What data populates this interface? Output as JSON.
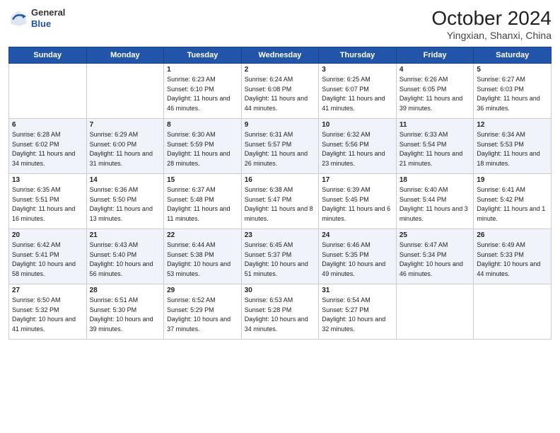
{
  "header": {
    "logo_line1": "General",
    "logo_line2": "Blue",
    "title": "October 2024",
    "subtitle": "Yingxian, Shanxi, China"
  },
  "days_of_week": [
    "Sunday",
    "Monday",
    "Tuesday",
    "Wednesday",
    "Thursday",
    "Friday",
    "Saturday"
  ],
  "weeks": [
    [
      {
        "day": "",
        "info": ""
      },
      {
        "day": "",
        "info": ""
      },
      {
        "day": "1",
        "info": "Sunrise: 6:23 AM\nSunset: 6:10 PM\nDaylight: 11 hours and 46 minutes."
      },
      {
        "day": "2",
        "info": "Sunrise: 6:24 AM\nSunset: 6:08 PM\nDaylight: 11 hours and 44 minutes."
      },
      {
        "day": "3",
        "info": "Sunrise: 6:25 AM\nSunset: 6:07 PM\nDaylight: 11 hours and 41 minutes."
      },
      {
        "day": "4",
        "info": "Sunrise: 6:26 AM\nSunset: 6:05 PM\nDaylight: 11 hours and 39 minutes."
      },
      {
        "day": "5",
        "info": "Sunrise: 6:27 AM\nSunset: 6:03 PM\nDaylight: 11 hours and 36 minutes."
      }
    ],
    [
      {
        "day": "6",
        "info": "Sunrise: 6:28 AM\nSunset: 6:02 PM\nDaylight: 11 hours and 34 minutes."
      },
      {
        "day": "7",
        "info": "Sunrise: 6:29 AM\nSunset: 6:00 PM\nDaylight: 11 hours and 31 minutes."
      },
      {
        "day": "8",
        "info": "Sunrise: 6:30 AM\nSunset: 5:59 PM\nDaylight: 11 hours and 28 minutes."
      },
      {
        "day": "9",
        "info": "Sunrise: 6:31 AM\nSunset: 5:57 PM\nDaylight: 11 hours and 26 minutes."
      },
      {
        "day": "10",
        "info": "Sunrise: 6:32 AM\nSunset: 5:56 PM\nDaylight: 11 hours and 23 minutes."
      },
      {
        "day": "11",
        "info": "Sunrise: 6:33 AM\nSunset: 5:54 PM\nDaylight: 11 hours and 21 minutes."
      },
      {
        "day": "12",
        "info": "Sunrise: 6:34 AM\nSunset: 5:53 PM\nDaylight: 11 hours and 18 minutes."
      }
    ],
    [
      {
        "day": "13",
        "info": "Sunrise: 6:35 AM\nSunset: 5:51 PM\nDaylight: 11 hours and 16 minutes."
      },
      {
        "day": "14",
        "info": "Sunrise: 6:36 AM\nSunset: 5:50 PM\nDaylight: 11 hours and 13 minutes."
      },
      {
        "day": "15",
        "info": "Sunrise: 6:37 AM\nSunset: 5:48 PM\nDaylight: 11 hours and 11 minutes."
      },
      {
        "day": "16",
        "info": "Sunrise: 6:38 AM\nSunset: 5:47 PM\nDaylight: 11 hours and 8 minutes."
      },
      {
        "day": "17",
        "info": "Sunrise: 6:39 AM\nSunset: 5:45 PM\nDaylight: 11 hours and 6 minutes."
      },
      {
        "day": "18",
        "info": "Sunrise: 6:40 AM\nSunset: 5:44 PM\nDaylight: 11 hours and 3 minutes."
      },
      {
        "day": "19",
        "info": "Sunrise: 6:41 AM\nSunset: 5:42 PM\nDaylight: 11 hours and 1 minute."
      }
    ],
    [
      {
        "day": "20",
        "info": "Sunrise: 6:42 AM\nSunset: 5:41 PM\nDaylight: 10 hours and 58 minutes."
      },
      {
        "day": "21",
        "info": "Sunrise: 6:43 AM\nSunset: 5:40 PM\nDaylight: 10 hours and 56 minutes."
      },
      {
        "day": "22",
        "info": "Sunrise: 6:44 AM\nSunset: 5:38 PM\nDaylight: 10 hours and 53 minutes."
      },
      {
        "day": "23",
        "info": "Sunrise: 6:45 AM\nSunset: 5:37 PM\nDaylight: 10 hours and 51 minutes."
      },
      {
        "day": "24",
        "info": "Sunrise: 6:46 AM\nSunset: 5:35 PM\nDaylight: 10 hours and 49 minutes."
      },
      {
        "day": "25",
        "info": "Sunrise: 6:47 AM\nSunset: 5:34 PM\nDaylight: 10 hours and 46 minutes."
      },
      {
        "day": "26",
        "info": "Sunrise: 6:49 AM\nSunset: 5:33 PM\nDaylight: 10 hours and 44 minutes."
      }
    ],
    [
      {
        "day": "27",
        "info": "Sunrise: 6:50 AM\nSunset: 5:32 PM\nDaylight: 10 hours and 41 minutes."
      },
      {
        "day": "28",
        "info": "Sunrise: 6:51 AM\nSunset: 5:30 PM\nDaylight: 10 hours and 39 minutes."
      },
      {
        "day": "29",
        "info": "Sunrise: 6:52 AM\nSunset: 5:29 PM\nDaylight: 10 hours and 37 minutes."
      },
      {
        "day": "30",
        "info": "Sunrise: 6:53 AM\nSunset: 5:28 PM\nDaylight: 10 hours and 34 minutes."
      },
      {
        "day": "31",
        "info": "Sunrise: 6:54 AM\nSunset: 5:27 PM\nDaylight: 10 hours and 32 minutes."
      },
      {
        "day": "",
        "info": ""
      },
      {
        "day": "",
        "info": ""
      }
    ]
  ]
}
